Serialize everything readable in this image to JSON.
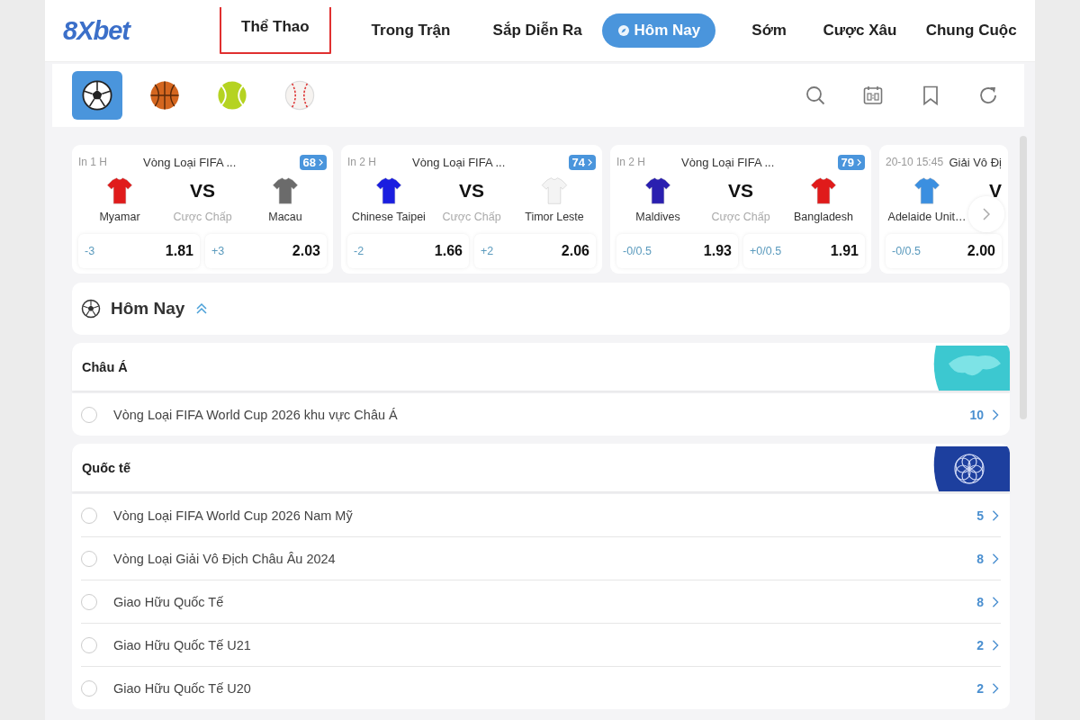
{
  "logo": "8Xbet",
  "nav": [
    {
      "label": "Thể Thao",
      "selected": false,
      "highlighted": true
    },
    {
      "label": "Trong Trận",
      "selected": false,
      "highlighted": false
    },
    {
      "label": "Sắp Diễn Ra",
      "selected": false,
      "highlighted": false
    },
    {
      "label": "Hôm Nay",
      "selected": true,
      "highlighted": false
    },
    {
      "label": "Sớm",
      "selected": false,
      "highlighted": false
    },
    {
      "label": "Cược Xâu",
      "selected": false,
      "highlighted": false
    },
    {
      "label": "Chung Cuộc",
      "selected": false,
      "highlighted": false
    }
  ],
  "sports": [
    {
      "kind": "soccer",
      "selected": true
    },
    {
      "kind": "basketball",
      "selected": false
    },
    {
      "kind": "tennis",
      "selected": false
    },
    {
      "kind": "baseball",
      "selected": false
    }
  ],
  "matches": [
    {
      "time": "In 1 H",
      "league": "Vòng Loại FIFA ...",
      "count": "68",
      "home": {
        "name": "Myamar",
        "color": "#e01b1b"
      },
      "vs": "VS",
      "market": "Cược Chấp",
      "away": {
        "name": "Macau",
        "color": "#6b6b6b"
      },
      "odds": [
        {
          "line": "-3",
          "price": "1.81"
        },
        {
          "line": "+3",
          "price": "2.03"
        }
      ]
    },
    {
      "time": "In 2 H",
      "league": "Vòng Loại FIFA ...",
      "count": "74",
      "home": {
        "name": "Chinese Taipei",
        "color": "#1a1ee0"
      },
      "vs": "VS",
      "market": "Cược Chấp",
      "away": {
        "name": "Timor Leste",
        "color": "#f4f4f4"
      },
      "odds": [
        {
          "line": "-2",
          "price": "1.66"
        },
        {
          "line": "+2",
          "price": "2.06"
        }
      ]
    },
    {
      "time": "In 2 H",
      "league": "Vòng Loại FIFA ...",
      "count": "79",
      "home": {
        "name": "Maldives",
        "color": "#2a1fb0"
      },
      "vs": "VS",
      "market": "Cược Chấp",
      "away": {
        "name": "Bangladesh",
        "color": "#e01b1b"
      },
      "odds": [
        {
          "line": "-0/0.5",
          "price": "1.93"
        },
        {
          "line": "+0/0.5",
          "price": "1.91"
        }
      ]
    },
    {
      "time": "20-10 15:45",
      "league": "Giải Vô Đị",
      "home": {
        "name": "Adelaide Unit…",
        "color": "#3b8fe0"
      },
      "vs": "V",
      "odds": [
        {
          "line": "-0/0.5",
          "price": "2.00"
        }
      ]
    }
  ],
  "today": {
    "title": "Hôm Nay"
  },
  "groups": [
    {
      "title": "Châu Á",
      "kind": "map",
      "rows": [
        {
          "name": "Vòng Loại FIFA World Cup 2026 khu vực Châu Á",
          "count": "10",
          "selected": false
        }
      ]
    },
    {
      "title": "Quốc tế",
      "kind": "emblem",
      "rows": [
        {
          "name": "Vòng Loại FIFA World Cup 2026 Nam Mỹ",
          "count": "5",
          "selected": false
        },
        {
          "name": "Vòng Loại Giải Vô Địch Châu Âu 2024",
          "count": "8",
          "selected": false
        },
        {
          "name": "Giao Hữu Quốc Tế",
          "count": "8",
          "selected": false
        },
        {
          "name": "Giao Hữu Quốc Tế U21",
          "count": "2",
          "selected": false
        },
        {
          "name": "Giao Hữu Quốc Tế U20",
          "count": "2",
          "selected": false
        }
      ]
    }
  ]
}
